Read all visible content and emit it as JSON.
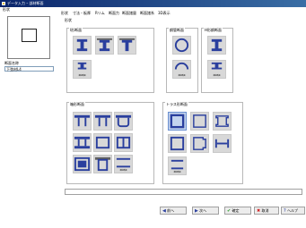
{
  "window": {
    "title": "データ入力 ｰ 部材断面"
  },
  "left_panel": {
    "shape_label": "形状",
    "name_label": "断面名称",
    "name_value": "下弦材L4"
  },
  "tabs": [
    "形状",
    "寸法・板厚",
    "Rリム",
    "断面力",
    "断面諸量",
    "断面諸系",
    "3D表示"
  ],
  "section_label": "形状",
  "groups": {
    "i_section": "I形断面",
    "circle_section": "鋼管断面",
    "h_section": "H形鋼断面",
    "box_section": "箱形断面",
    "truss_section": "トラス形断面"
  },
  "captions": {
    "composite": "溶接断面",
    "circle_composite": "溶接断面",
    "h_composite": "溶接断面",
    "box_composite": "溶接断面",
    "truss_composite": "溶接断面"
  },
  "footer": {
    "prev_label": "前へ",
    "next_label": "次へ",
    "ok_label": "確定",
    "cancel_label": "取消",
    "help_label": "ヘルプ"
  },
  "colors": {
    "accent": "#2a3f9e",
    "selected": "#c4d4ee",
    "button_bg": "#d8d8d8"
  }
}
